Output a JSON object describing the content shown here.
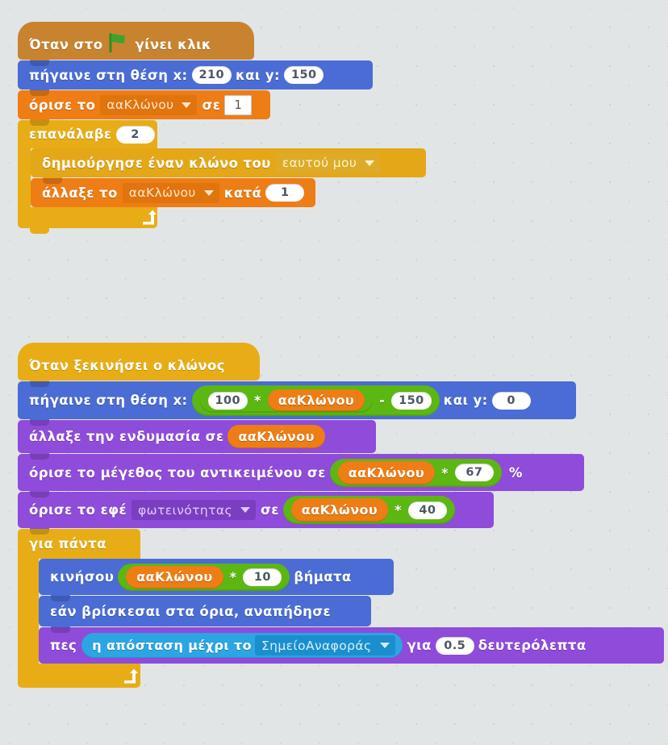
{
  "canvas": {
    "background_color": "#e2e5e6",
    "app": "Scratch block editor workspace",
    "language": "el"
  },
  "palette": {
    "events": "#c88330",
    "control": "#e8ad16",
    "motion": "#4a6cd4",
    "looks": "#8f4bd9",
    "data": "#ee7d16",
    "sensing": "#2ca5e2",
    "operators": "#5cb712",
    "input_white": "#ffffff"
  },
  "scripts": [
    {
      "id": "script-green-flag",
      "hat": {
        "label_before": "Όταν στο",
        "icon": "green-flag-icon",
        "label_after": "γίνει κλικ"
      },
      "blocks": {
        "goto": {
          "label_1": "πήγαινε στη θέση x:",
          "x_value": "210",
          "label_2": "και y:",
          "y_value": "150"
        },
        "set_var": {
          "label_1": "όρισε το",
          "variable": "ααΚλώνου",
          "label_2": "σε",
          "value": "1"
        },
        "repeat": {
          "label": "επανάλαβε",
          "times": "2",
          "children": {
            "create_clone": {
              "label": "δημιούργησε έναν κλώνο του",
              "target": "εαυτού μου"
            },
            "change_var": {
              "label_1": "άλλαξε το",
              "variable": "ααΚλώνου",
              "label_2": "κατά",
              "value": "1"
            }
          }
        }
      }
    },
    {
      "id": "script-clone-start",
      "hat": {
        "label": "Όταν ξεκινήσει ο κλώνος"
      },
      "blocks": {
        "goto": {
          "label_1": "πήγαινε στη θέση x:",
          "operand_a": "100",
          "op_mul": "*",
          "variable": "ααΚλώνου",
          "op_sub": "-",
          "operand_b": "150",
          "label_2": "και y:",
          "y_value": "0"
        },
        "switch_costume": {
          "label": "άλλαξε την ενδυμασία σε",
          "variable": "ααΚλώνου"
        },
        "set_size": {
          "label": "όρισε το μέγεθος του αντικειμένου σε",
          "variable": "ααΚλώνου",
          "op_mul": "*",
          "factor": "67",
          "unit": "%"
        },
        "set_effect": {
          "label_1": "όρισε το εφέ",
          "effect": "φωτεινότητας",
          "label_2": "σε",
          "variable": "ααΚλώνου",
          "op_mul": "*",
          "factor": "40"
        },
        "forever": {
          "label": "για πάντα",
          "children": {
            "move": {
              "label_1": "κινήσου",
              "variable": "ααΚλώνου",
              "op_mul": "*",
              "steps": "10",
              "label_2": "βήματα"
            },
            "bounce": {
              "label": "εάν βρίσκεσαι στα όρια, αναπήδησε"
            },
            "say": {
              "label_1": "πες",
              "sensing_label": "η απόσταση μέχρι το",
              "sensing_target": "ΣημείοΑναφοράς",
              "label_2": "για",
              "seconds": "0.5",
              "label_3": "δευτερόλεπτα"
            }
          }
        }
      }
    }
  ]
}
